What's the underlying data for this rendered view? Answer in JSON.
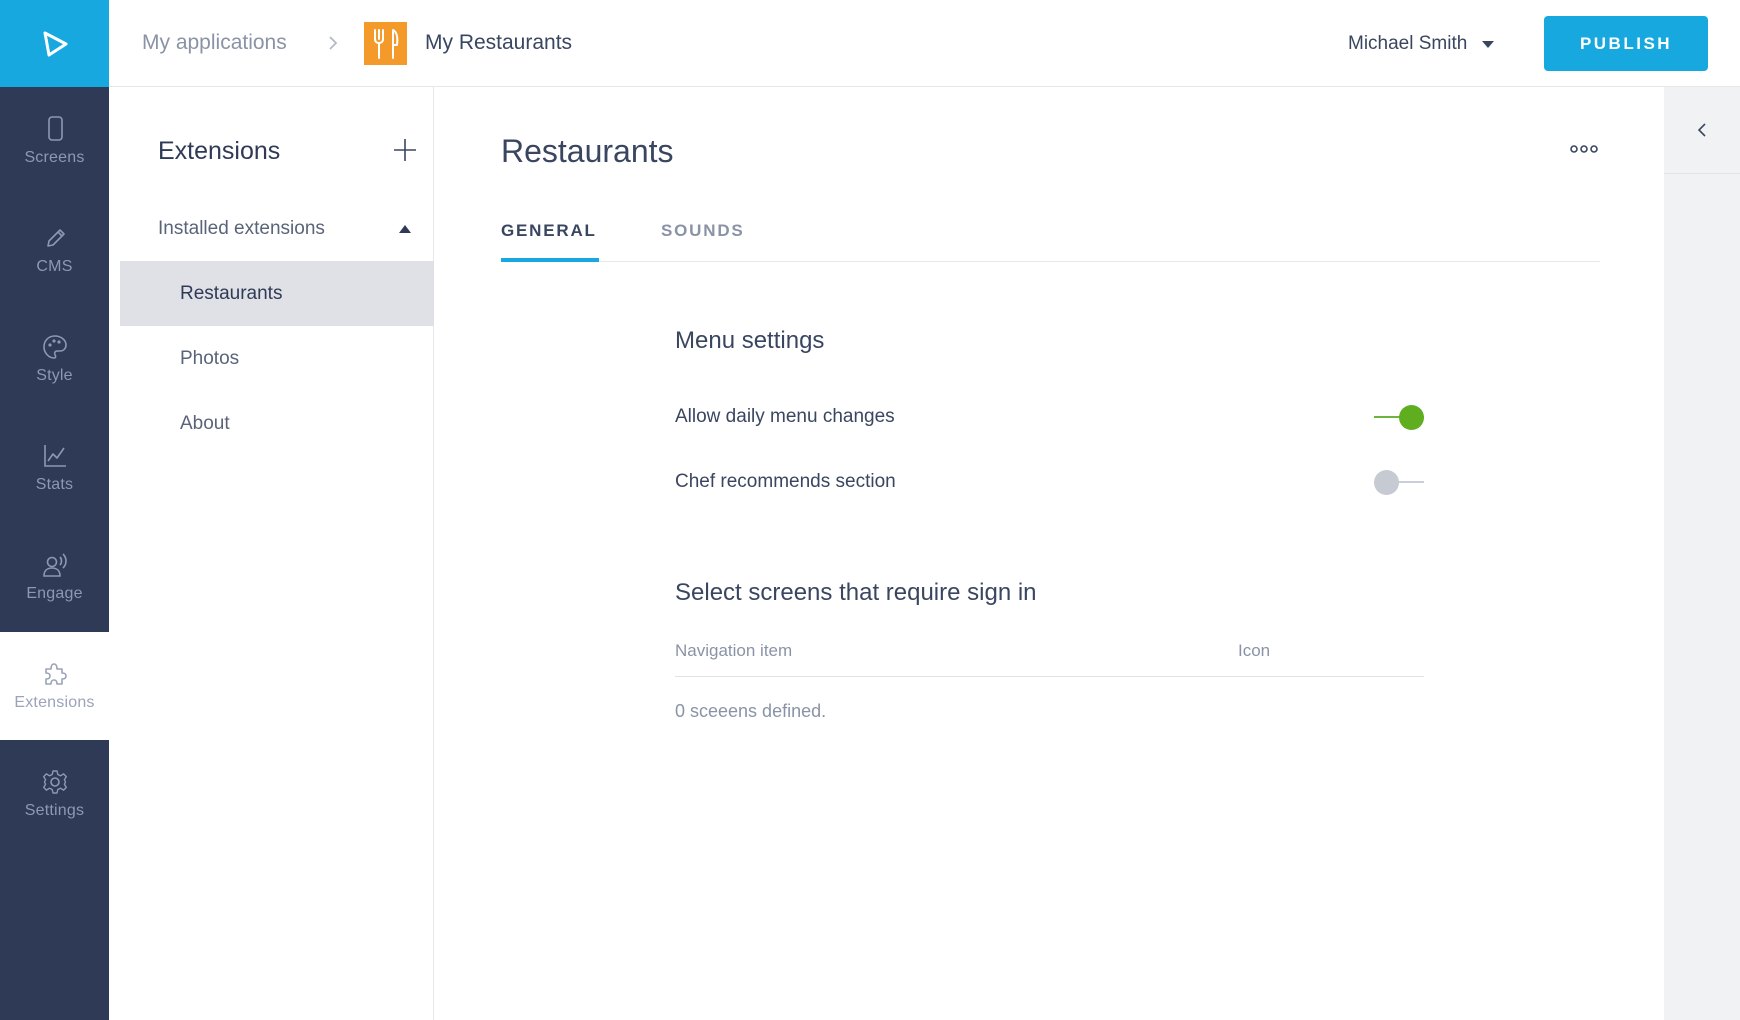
{
  "colors": {
    "brand": "#17a8e0",
    "nav_bg": "#2f3a56",
    "app_tile": "#f39a2a",
    "toggle_on": "#5fae1f",
    "toggle_off": "#c6cad3"
  },
  "leftnav": {
    "logo_icon": "play-triangle-icon",
    "items": [
      {
        "label": "Screens",
        "icon": "phone-icon"
      },
      {
        "label": "CMS",
        "icon": "pencil-icon"
      },
      {
        "label": "Style",
        "icon": "palette-icon"
      },
      {
        "label": "Stats",
        "icon": "line-chart-icon"
      },
      {
        "label": "Engage",
        "icon": "broadcast-user-icon"
      },
      {
        "label": "Extensions",
        "icon": "puzzle-icon",
        "active": true
      },
      {
        "label": "Settings",
        "icon": "gear-icon"
      }
    ]
  },
  "topbar": {
    "breadcrumb_root": "My applications",
    "app_icon": "fork-knife-icon",
    "app_name": "My Restaurants",
    "user_name": "Michael Smith",
    "publish_label": "PUBLISH"
  },
  "extensions": {
    "title": "Extensions",
    "group_label": "Installed extensions",
    "items": [
      {
        "label": "Restaurants",
        "selected": true
      },
      {
        "label": "Photos"
      },
      {
        "label": "About"
      }
    ]
  },
  "main": {
    "title": "Restaurants",
    "tabs": [
      {
        "label": "GENERAL",
        "active": true
      },
      {
        "label": "SOUNDS"
      }
    ],
    "menu_settings": {
      "title": "Menu settings",
      "toggles": [
        {
          "label": "Allow daily menu changes",
          "on": true
        },
        {
          "label": "Chef recommends section",
          "on": false
        }
      ]
    },
    "signin": {
      "title": "Select screens that require sign in",
      "columns": [
        "Navigation item",
        "Icon"
      ],
      "empty_text": "0 sceeens defined."
    }
  }
}
